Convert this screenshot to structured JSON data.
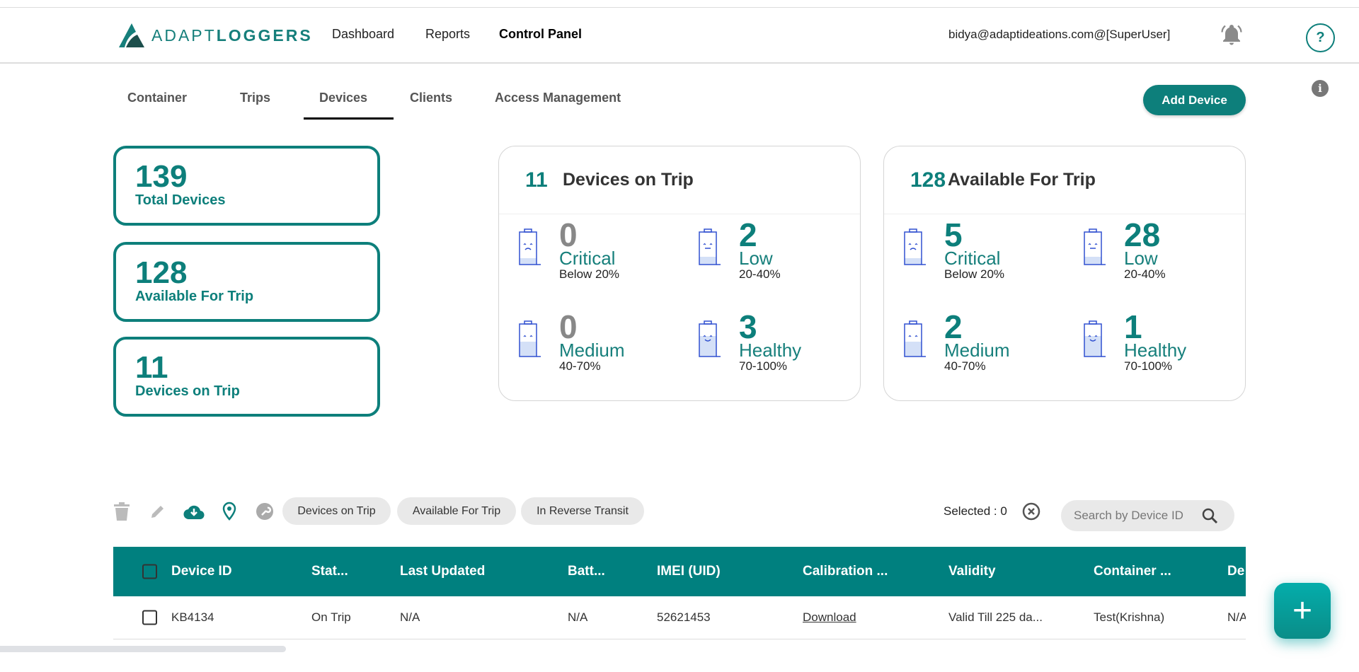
{
  "header": {
    "logo_text_light": "ADAPT",
    "logo_text_bold": "LOGGERS",
    "nav": [
      "Dashboard",
      "Reports",
      "Control Panel"
    ],
    "active_nav": "Control Panel",
    "user": "bidya@adaptideations.com@[SuperUser]",
    "help_label": "?",
    "info_label": "i"
  },
  "tabs": [
    "Container",
    "Trips",
    "Devices",
    "Clients",
    "Access Management"
  ],
  "active_tab": "Devices",
  "add_device_label": "Add Device",
  "summary": [
    {
      "value": "139",
      "label": "Total Devices"
    },
    {
      "value": "128",
      "label": "Available For Trip"
    },
    {
      "value": "11",
      "label": "Devices on Trip"
    }
  ],
  "battery_cards": [
    {
      "count": "11",
      "title": "Devices on Trip",
      "metrics": [
        {
          "value": "0",
          "label": "Critical",
          "range": "Below 20%",
          "face": "sad"
        },
        {
          "value": "2",
          "label": "Low",
          "range": "20-40%",
          "face": "neutral"
        },
        {
          "value": "0",
          "label": "Medium",
          "range": "40-70%",
          "face": "calm"
        },
        {
          "value": "3",
          "label": "Healthy",
          "range": "70-100%",
          "face": "happy"
        }
      ]
    },
    {
      "count": "128",
      "title": "Available For Trip",
      "metrics": [
        {
          "value": "5",
          "label": "Critical",
          "range": "Below 20%",
          "face": "sad"
        },
        {
          "value": "28",
          "label": "Low",
          "range": "20-40%",
          "face": "neutral"
        },
        {
          "value": "2",
          "label": "Medium",
          "range": "40-70%",
          "face": "calm"
        },
        {
          "value": "1",
          "label": "Healthy",
          "range": "70-100%",
          "face": "happy"
        }
      ]
    }
  ],
  "colors": {
    "teal": "#0d7f7b",
    "table_header": "#00807f",
    "zero_value": "#888888",
    "battery": "#3050d0"
  },
  "toolbar": {
    "chips": [
      "Devices on Trip",
      "Available For Trip",
      "In Reverse Transit"
    ],
    "selected_label": "Selected : 0",
    "search_placeholder": "Search by Device ID"
  },
  "table": {
    "columns": [
      "Device ID",
      "Stat...",
      "Last Updated",
      "Batt...",
      "IMEI (UID)",
      "Calibration ...",
      "Validity",
      "Container ...",
      "De"
    ],
    "rows": [
      [
        "KB4134",
        "On Trip",
        "N/A",
        "N/A",
        "52621453",
        "Download",
        "Valid Till 225 da...",
        "Test(Krishna)",
        "N/A"
      ]
    ]
  },
  "fab_label": "+"
}
